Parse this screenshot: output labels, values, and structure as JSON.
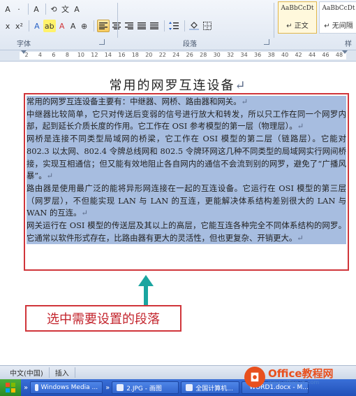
{
  "ribbon": {
    "row1": [
      "A",
      "·",
      "A",
      "ᴬ",
      "⟲",
      "文",
      "A"
    ],
    "row2": [
      "x",
      "x²",
      "A",
      "ab",
      "A",
      "A",
      "A",
      "⊕"
    ],
    "groups": {
      "font": "字体",
      "paragraph": "段落",
      "styles": "样式"
    },
    "styles": [
      {
        "sample": "AaBbCcDt",
        "name": "↵ 正文"
      },
      {
        "sample": "AaBbCcDt",
        "name": "↵ 无间隔"
      },
      {
        "sample": "AaBl",
        "name": ""
      }
    ]
  },
  "ruler": {
    "numbers": [
      "2",
      "4",
      "6",
      "8",
      "10",
      "12",
      "14",
      "16",
      "18",
      "20",
      "22",
      "24",
      "26",
      "28",
      "30",
      "32",
      "34",
      "36",
      "38",
      "40",
      "42",
      "44",
      "46",
      "48"
    ]
  },
  "document": {
    "title": "常用的网罗互连设备",
    "paragraphs": [
      "常用的网罗互连设备主要有：中继器、网桥、路由器和网关。",
      "中继器比较简单，它只对传送后变弱的信号进行放大和转发，所以只工作在同一个网罗内部，起到延长介质长度的作用。它工作在 OSI 参考模型的第一层（物理层）。",
      "网桥是连接不同类型局域网的桥梁，它工作在 OSI 模型的第二层（链路层）。它能对 802.3 以太网、802.4 令牌总线网和 802.5 令牌环网这几种不同类型的局域网实行网间桥接，实现互相通信；但又能有效地阻止各自网内的通信不会流到别的网罗，避免了“广播风暴”。",
      "路由器是使用最广泛的能将异形网连接在一起的互连设备。它运行在 OSI 模型的第三层（网罗层），不但能实现 LAN 与 LAN 的互连，更能解决体系结构差别很大的 LAN 与 WAN 的互连。",
      "网关运行在 OSI 模型的传送层及其以上的高层，它能互连各种完全不同体系结构的网罗。它通常以软件形式存在，比路由器有更大的灵活性，但也更复杂、开销更大。"
    ],
    "paragraph_mark": "↵",
    "callout": "选中需要设置的段落"
  },
  "status": {
    "language": "中文(中国)",
    "mode": "插入"
  },
  "taskbar": {
    "items": [
      "Windows Media ...",
      "2.JPG - 画图",
      "全国计算机...",
      "WORD1.docx - M..."
    ]
  },
  "watermark": {
    "main": "Office教程网",
    "sub": "www.office26.com"
  },
  "colors": {
    "selection": "#a7bde0",
    "highlight_border": "#d0353a",
    "callout_text": "#c3252d",
    "arrow": "#1aa5a0"
  }
}
